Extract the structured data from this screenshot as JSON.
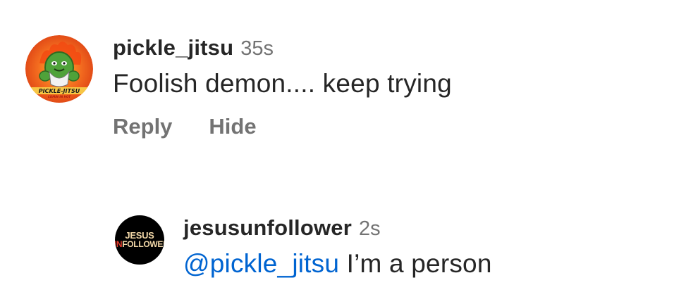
{
  "comments": [
    {
      "username": "pickle_jitsu",
      "timestamp": "35s",
      "text": "Foolish demon.... keep trying",
      "avatar": {
        "icon": "pickle-jitsu-avatar",
        "logo_text": "PICKLE-JITSU",
        "logo_subtext": "COMIN IN HOT",
        "bg_color": "#e8501e"
      },
      "actions": {
        "reply": "Reply",
        "hide": "Hide"
      }
    },
    {
      "username": "jesusunfollower",
      "timestamp": "2s",
      "mention": "@pickle_jitsu",
      "text": " I’m a person",
      "avatar": {
        "icon": "jesus-unfollower-avatar",
        "logo_line1": "JESUS",
        "logo_line2_red": "UN",
        "logo_line2_rest": "FOLLOWER",
        "bg_color": "#000000"
      }
    }
  ],
  "colors": {
    "text": "#262626",
    "muted": "#737373",
    "mention": "#0064d1"
  }
}
